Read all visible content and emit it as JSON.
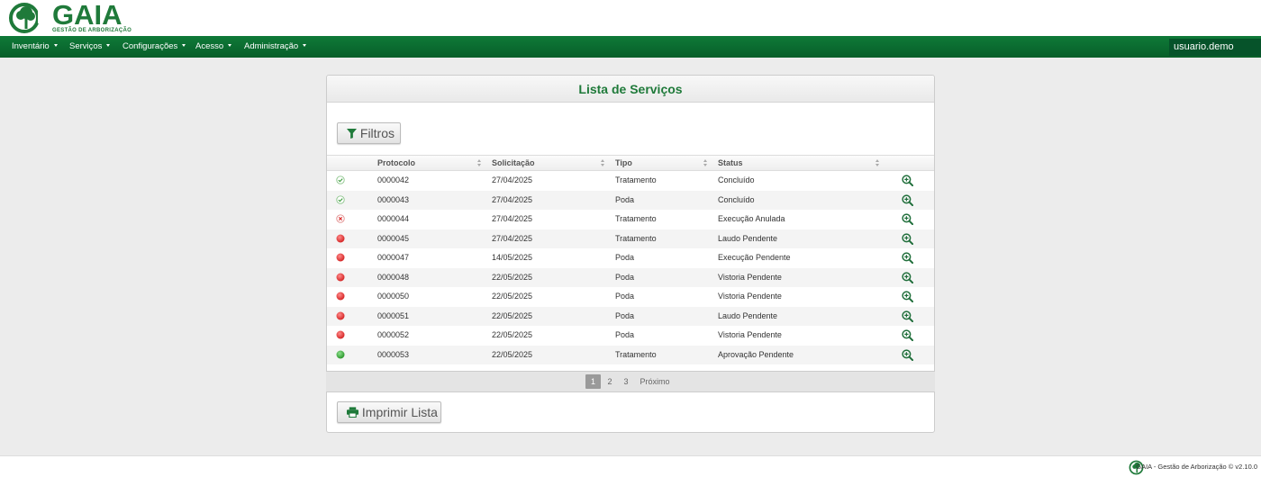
{
  "header": {
    "logo_text": "GAIA",
    "logo_sub": "GESTÃO DE ARBORIZAÇÃO"
  },
  "nav": {
    "items": [
      {
        "label": "Inventário"
      },
      {
        "label": "Serviços"
      },
      {
        "label": "Configurações"
      },
      {
        "label": "Acesso"
      },
      {
        "label": "Administração"
      }
    ],
    "user": "usuario.demo"
  },
  "panel": {
    "title": "Lista de Serviços",
    "filter_button": "Filtros",
    "print_button": "Imprimir Lista"
  },
  "table": {
    "headers": [
      "Protocolo",
      "Solicitação",
      "Tipo",
      "Status"
    ],
    "rows": [
      {
        "status_icon": "check-icon",
        "protocolo": "0000042",
        "data": "27/04/2025",
        "tipo": "Tratamento",
        "status": "Concluído"
      },
      {
        "status_icon": "check-icon",
        "protocolo": "0000043",
        "data": "27/04/2025",
        "tipo": "Poda",
        "status": "Concluído"
      },
      {
        "status_icon": "cancel-icon",
        "protocolo": "0000044",
        "data": "27/04/2025",
        "tipo": "Tratamento",
        "status": "Execução Anulada"
      },
      {
        "status_icon": "red-dot-icon",
        "protocolo": "0000045",
        "data": "27/04/2025",
        "tipo": "Tratamento",
        "status": "Laudo Pendente"
      },
      {
        "status_icon": "red-dot-icon",
        "protocolo": "0000047",
        "data": "14/05/2025",
        "tipo": "Poda",
        "status": "Execução Pendente"
      },
      {
        "status_icon": "red-dot-icon",
        "protocolo": "0000048",
        "data": "22/05/2025",
        "tipo": "Poda",
        "status": "Vistoria Pendente"
      },
      {
        "status_icon": "red-dot-icon",
        "protocolo": "0000050",
        "data": "22/05/2025",
        "tipo": "Poda",
        "status": "Vistoria Pendente"
      },
      {
        "status_icon": "red-dot-icon",
        "protocolo": "0000051",
        "data": "22/05/2025",
        "tipo": "Poda",
        "status": "Laudo Pendente"
      },
      {
        "status_icon": "red-dot-icon",
        "protocolo": "0000052",
        "data": "22/05/2025",
        "tipo": "Poda",
        "status": "Vistoria Pendente"
      },
      {
        "status_icon": "green-dot-icon",
        "protocolo": "0000053",
        "data": "22/05/2025",
        "tipo": "Tratamento",
        "status": "Aprovação Pendente"
      }
    ]
  },
  "pagination": {
    "pages": [
      "1",
      "2",
      "3"
    ],
    "active": "1",
    "next_label": "Próximo"
  },
  "footer": {
    "text": "GAIA - Gestão de Arborização © v2.10.0"
  },
  "colors": {
    "brand_green": "#1f7a3a",
    "navbar_green": "#0a6b31",
    "status_red": "#e53935",
    "status_green": "#43a047"
  }
}
